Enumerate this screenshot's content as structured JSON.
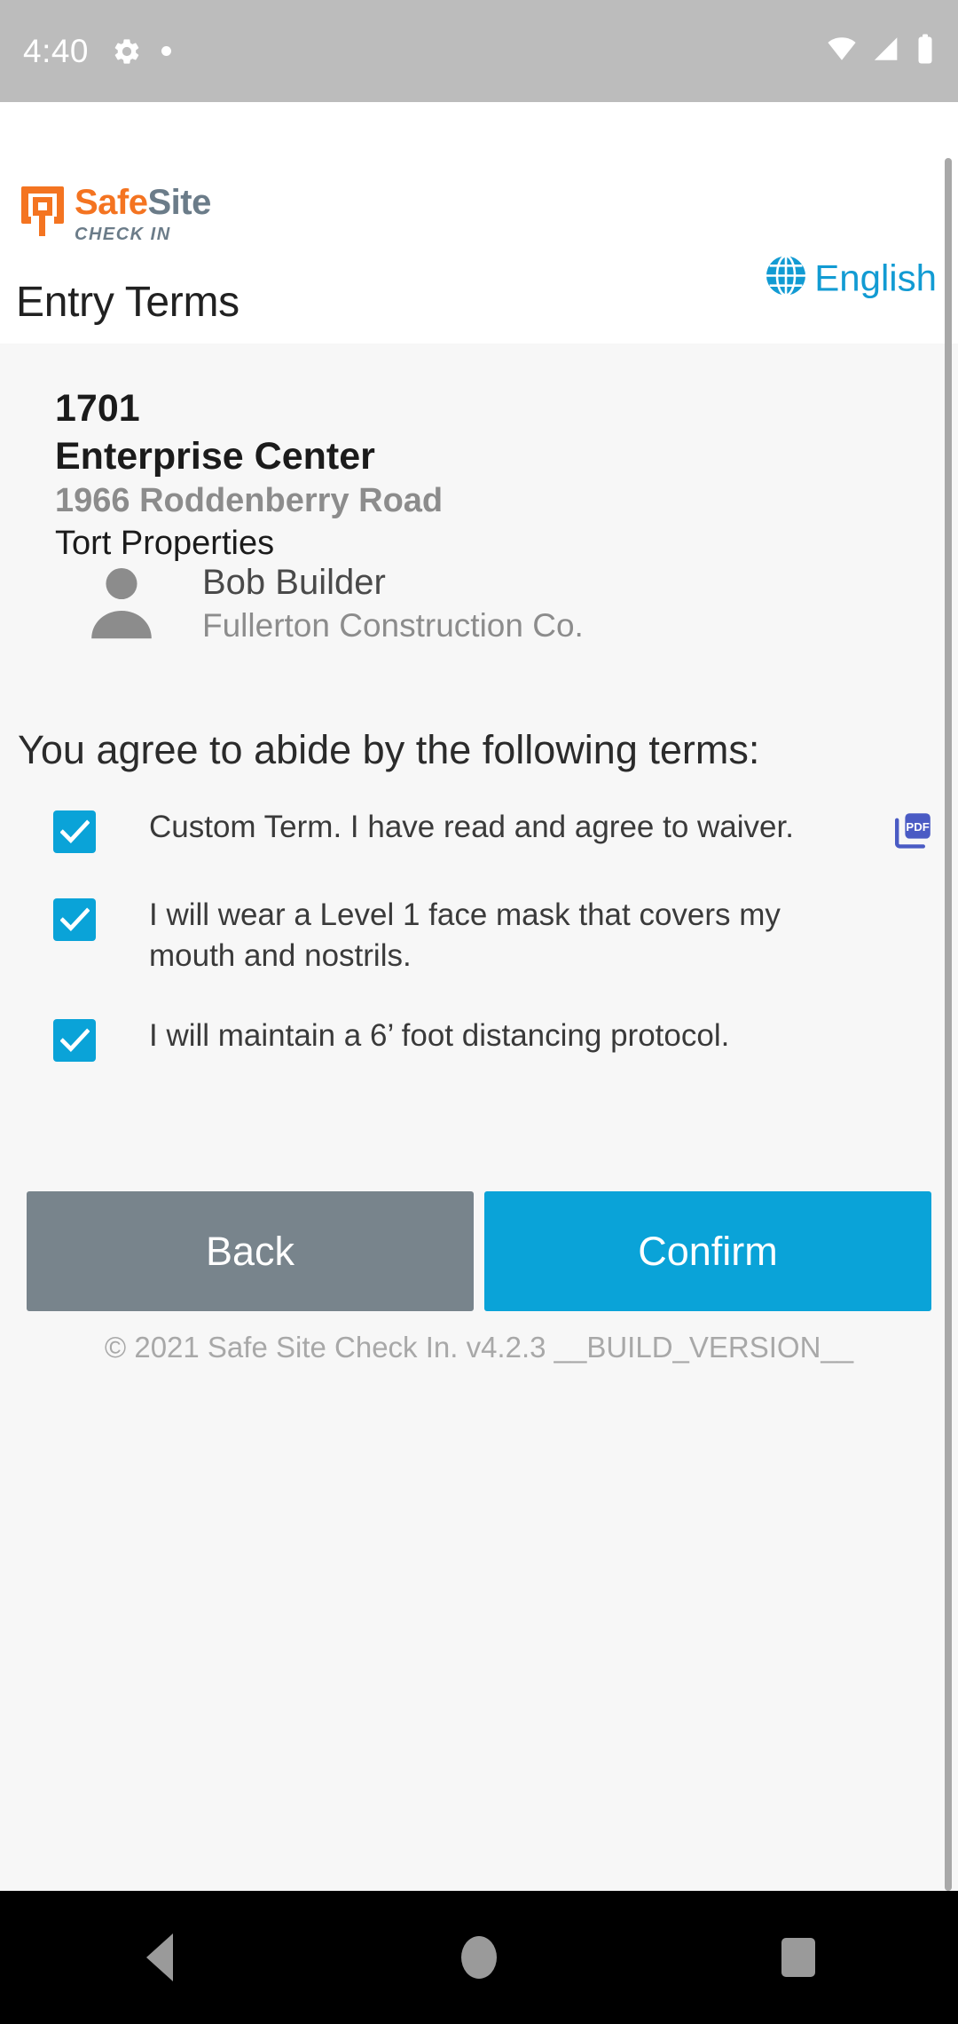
{
  "status_bar": {
    "time": "4:40",
    "icons": [
      "gear-icon",
      "dot-indicator",
      "wifi-icon",
      "cellular-signal-icon",
      "battery-icon"
    ]
  },
  "header": {
    "logo": {
      "safe": "Safe",
      "site": "Site",
      "tagline": "CHECK IN",
      "mark_color": "#f47421",
      "word_color": "#6b7c89"
    },
    "language": {
      "label": "English",
      "icon": "globe-icon",
      "color": "#129bd3"
    },
    "page_title": "Entry Terms"
  },
  "site": {
    "number": "1701",
    "name": "Enterprise Center",
    "address": "1966 Roddenberry Road",
    "owner": "Tort Properties"
  },
  "visitor": {
    "avatar_icon": "person-avatar-icon",
    "name": "Bob Builder",
    "company": "Fullerton Construction Co."
  },
  "terms": {
    "heading": "You agree to abide by the following terms:",
    "items": [
      {
        "label": "Custom Term. I have read and agree to waiver.",
        "checked": true,
        "attachment": "PDF"
      },
      {
        "label": "I will wear a Level 1 face mask that covers my mouth and nostrils.",
        "checked": true,
        "attachment": null
      },
      {
        "label": "I will maintain a 6’ foot distancing protocol.",
        "checked": true,
        "attachment": null
      }
    ]
  },
  "actions": {
    "back_label": "Back",
    "confirm_label": "Confirm",
    "back_color": "#78848c",
    "confirm_color": "#0aa3d8"
  },
  "footer": {
    "text": "© 2021 Safe Site Check In. v4.2.3 __BUILD_VERSION__"
  },
  "nav_bar": {
    "back_icon": "nav-back-triangle-icon",
    "home_icon": "nav-home-circle-icon",
    "recents_icon": "nav-recents-square-icon"
  },
  "colors": {
    "accent": "#0aa3d8",
    "brand_orange": "#f47421",
    "pdf_blue": "#4a5bc4"
  }
}
